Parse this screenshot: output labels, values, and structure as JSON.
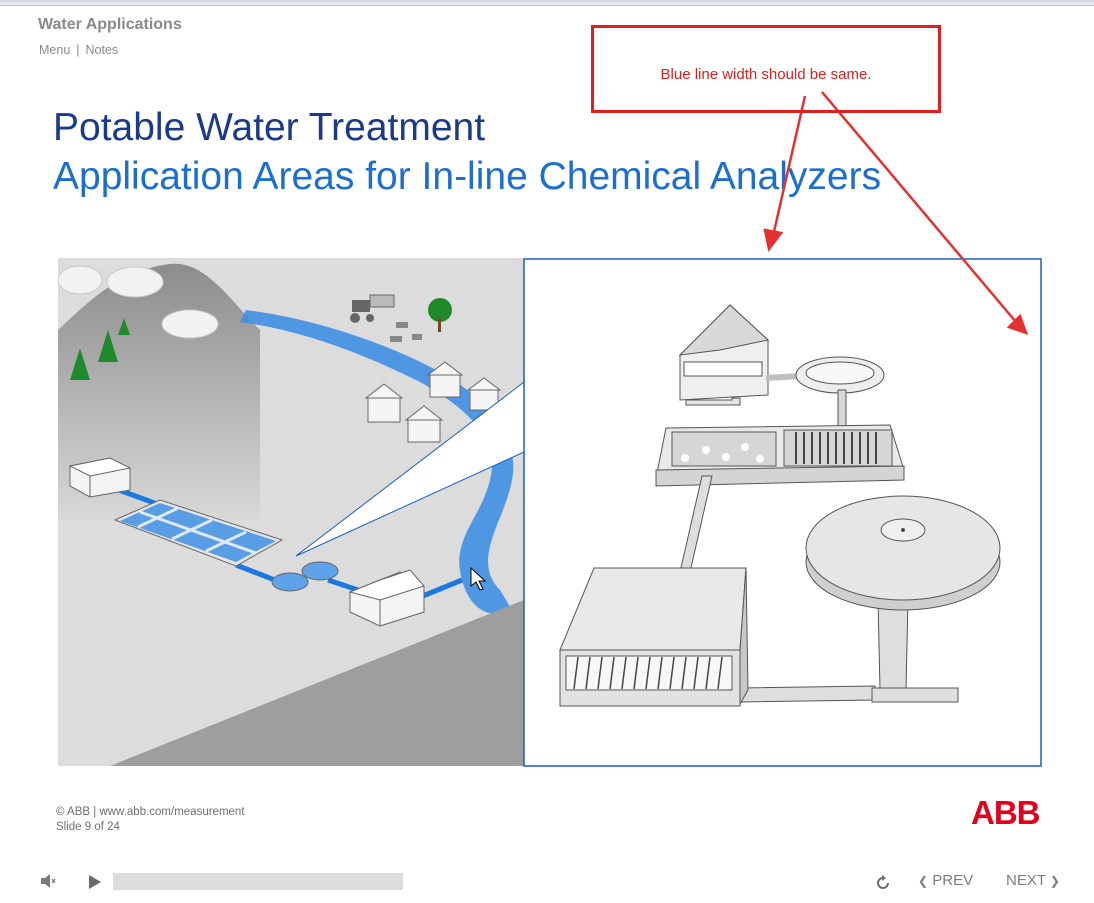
{
  "header": {
    "app_title": "Water Applications",
    "menu_label": "Menu",
    "notes_label": "Notes",
    "separator": "|"
  },
  "slide": {
    "title": "Potable Water Treatment",
    "subtitle": "Application Areas for In-line Chemical Analyzers"
  },
  "annotation": {
    "text": "Blue line width should be same."
  },
  "footer": {
    "copyright": "© ABB | www.abb.com/measurement",
    "slide_counter": "Slide 9 of 24",
    "logo": "ABB"
  },
  "player": {
    "prev_label": "PREV",
    "next_label": "NEXT",
    "progress": 0
  },
  "colors": {
    "title_dark_blue": "#1b3a8c",
    "title_blue": "#1c6fd1",
    "annotation_red": "#e11d1d",
    "abb_red": "#e2001a",
    "river_blue": "#3f8fe3"
  }
}
